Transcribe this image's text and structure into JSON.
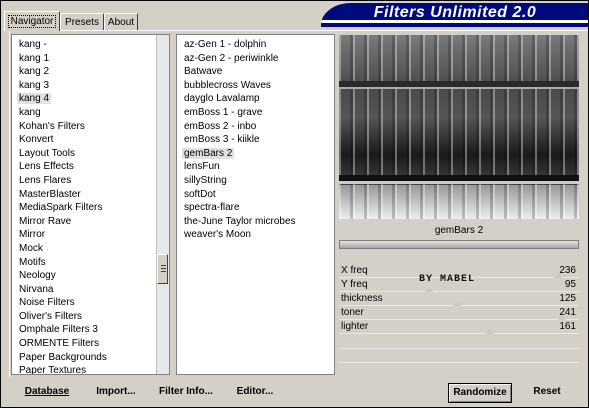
{
  "app": {
    "title": "Filters Unlimited 2.0"
  },
  "tabs": [
    {
      "label": "Navigator",
      "active": true
    },
    {
      "label": "Presets",
      "active": false
    },
    {
      "label": "About",
      "active": false
    }
  ],
  "categories": {
    "selected": "kang 4",
    "items": [
      "kang -",
      "kang 1",
      "kang 2",
      "kang 3",
      "kang 4",
      "kang",
      "Kohan's Filters",
      "Konvert",
      "Layout Tools",
      "Lens Effects",
      "Lens Flares",
      "MasterBlaster",
      "MediaSpark Filters",
      "Mirror Rave",
      "Mirror",
      "Mock",
      "Motifs",
      "Neology",
      "Nirvana",
      "Noise Filters",
      "Oliver's Filters",
      "Omphale Filters 3",
      "ORMENTE Filters",
      "Paper Backgrounds",
      "Paper Textures"
    ]
  },
  "filters": {
    "selected": "gemBars 2",
    "items": [
      "az-Gen 1  -  dolphin",
      "az-Gen 2  -  periwinkle",
      "Batwave",
      "bubblecross Waves",
      "dayglo Lavalamp",
      "emBoss 1  -  grave",
      "emBoss 2  -  inbo",
      "emBoss 3  -  kiikle",
      "gemBars 2",
      "lensFun",
      "sillyString",
      "softDot",
      "spectra-flare",
      "the-June Taylor microbes",
      "weaver's Moon"
    ]
  },
  "preview": {
    "label": "gemBars 2",
    "progress": 1.0
  },
  "watermark": "BY MABEL",
  "params": [
    {
      "label": "X freq",
      "value": "236",
      "level": 0.925
    },
    {
      "label": "Y freq",
      "value": "95",
      "level": 0.37
    },
    {
      "label": "thickness",
      "value": "125",
      "level": 0.49
    },
    {
      "label": "toner",
      "value": "241",
      "level": 0.945
    },
    {
      "label": "lighter",
      "value": "161",
      "level": 0.63
    }
  ],
  "buttons": {
    "database": "Database",
    "import": "Import...",
    "filter_info": "Filter Info...",
    "editor": "Editor...",
    "randomize": "Randomize",
    "reset": "Reset"
  },
  "colors": {
    "banner": "#000a7d",
    "face": "#d4d0c8"
  }
}
